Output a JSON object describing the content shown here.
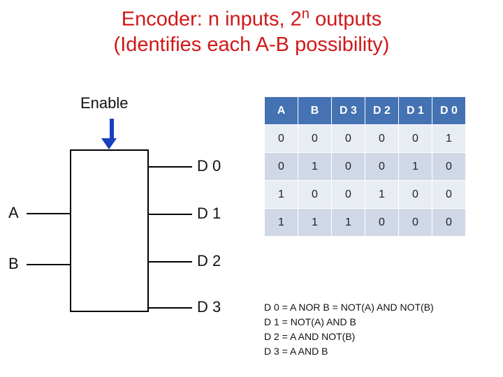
{
  "title_line1_a": "Encoder: n inputs, 2",
  "title_line1_b": " outputs",
  "title_sup": "n",
  "title_line2": "(Identifies each A-B possibility)",
  "enable_label": "Enable",
  "input_A": "A",
  "input_B": "B",
  "outputs": {
    "d0": "D 0",
    "d1": "D 1",
    "d2": "D 2",
    "d3": "D 3"
  },
  "table": {
    "headers": [
      "A",
      "B",
      "D 3",
      "D 2",
      "D 1",
      "D 0"
    ],
    "rows": [
      [
        "0",
        "0",
        "0",
        "0",
        "0",
        "1"
      ],
      [
        "0",
        "1",
        "0",
        "0",
        "1",
        "0"
      ],
      [
        "1",
        "0",
        "0",
        "1",
        "0",
        "0"
      ],
      [
        "1",
        "1",
        "1",
        "0",
        "0",
        "0"
      ]
    ]
  },
  "equations": [
    "D 0 = A NOR B = NOT(A) AND NOT(B)",
    "D 1 = NOT(A) AND B",
    "D 2 = A AND NOT(B)",
    "D 3 = A AND B"
  ]
}
